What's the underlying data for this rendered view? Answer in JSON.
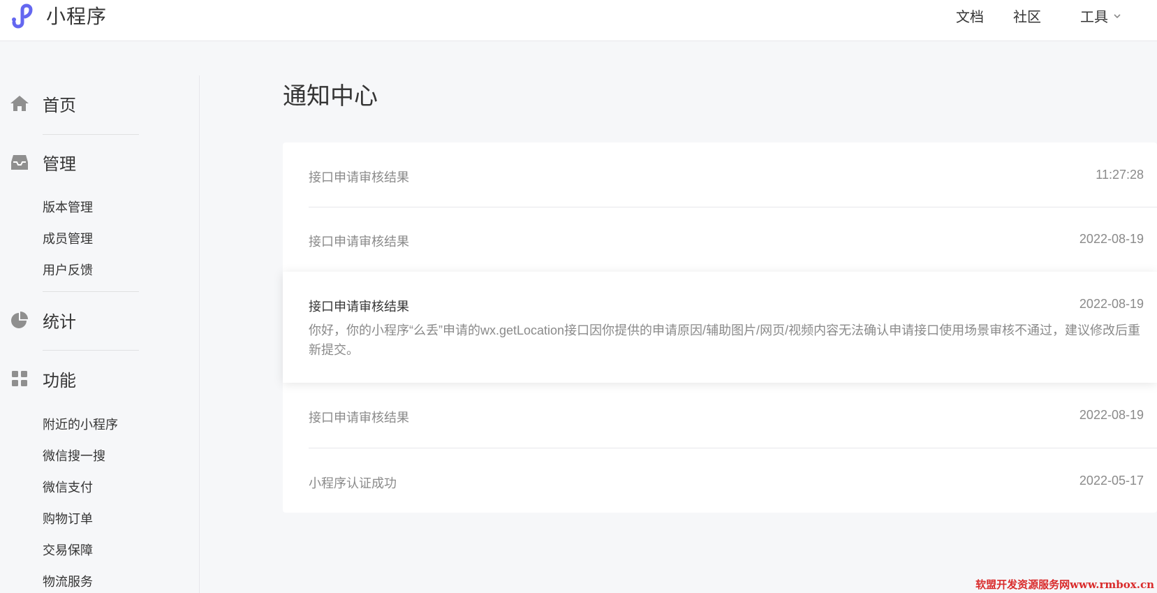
{
  "app": {
    "title": "小程序"
  },
  "topnav": {
    "docs": "文档",
    "community": "社区",
    "tools": "工具"
  },
  "sidebar": {
    "home": "首页",
    "manage": {
      "label": "管理",
      "items": [
        "版本管理",
        "成员管理",
        "用户反馈"
      ]
    },
    "stats": {
      "label": "统计"
    },
    "features": {
      "label": "功能",
      "items": [
        "附近的小程序",
        "微信搜一搜",
        "微信支付",
        "购物订单",
        "交易保障",
        "物流服务"
      ]
    }
  },
  "main": {
    "title": "通知中心",
    "messages": [
      {
        "title": "接口申请审核结果",
        "date": "11:27:28"
      },
      {
        "title": "接口申请审核结果",
        "date": "2022-08-19"
      },
      {
        "title": "接口申请审核结果",
        "date": "2022-08-19",
        "body": "你好，你的小程序“么丢”申请的wx.getLocation接口因你提供的申请原因/辅助图片/网页/视频内容无法确认申请接口使用场景审核不通过，建议修改后重新提交。"
      },
      {
        "title": "接口申请审核结果",
        "date": "2022-08-19"
      },
      {
        "title": "小程序认证成功",
        "date": "2022-05-17"
      }
    ]
  },
  "watermark": "软盟开发资源服务网www.rmbox.cn",
  "colors": {
    "brand": "#6467f0",
    "text": "#353535",
    "muted": "#8a8a8a",
    "icon": "#8f8f8f",
    "background": "#f6f7f9"
  }
}
